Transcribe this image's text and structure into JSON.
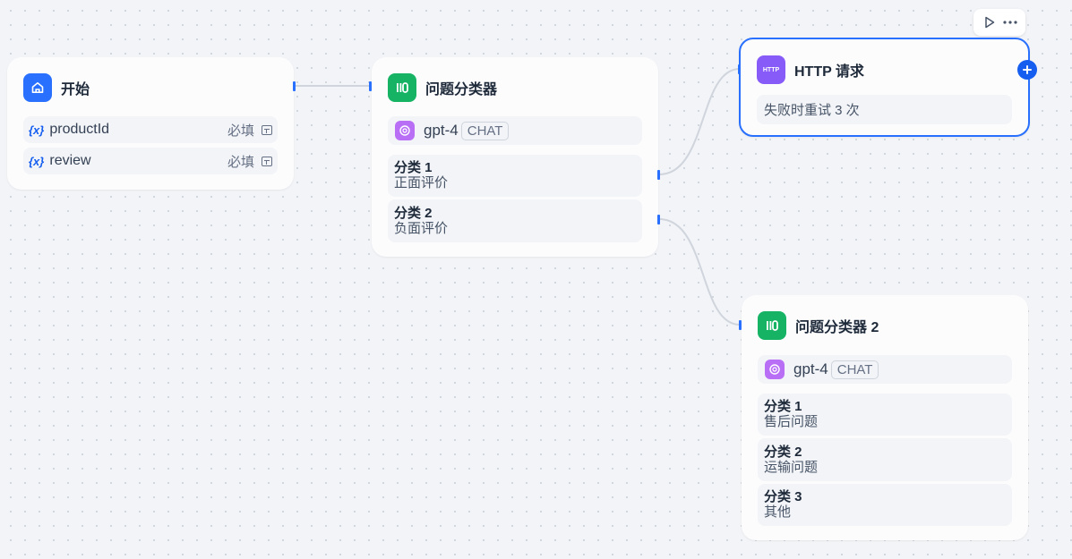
{
  "colors": {
    "accent": "#2970ff",
    "start_icon_bg": "#2970ff",
    "classifier_icon_bg": "#16b364",
    "http_icon_bg": "#875bf7",
    "model_icon_bg": "#b86ef5"
  },
  "toolbar": {
    "run_icon": "play-icon",
    "more_icon": "more-icon"
  },
  "start_node": {
    "title": "开始",
    "icon": "home-icon",
    "variables": [
      {
        "icon_text": "{x}",
        "name": "productId",
        "required": "必填"
      },
      {
        "icon_text": "{x}",
        "name": "review",
        "required": "必填"
      }
    ]
  },
  "classifier_node": {
    "title": "问题分类器",
    "icon": "classifier-icon",
    "model": {
      "name": "gpt-4",
      "mode": "CHAT"
    },
    "classes": [
      {
        "name": "分类 1",
        "desc": "正面评价"
      },
      {
        "name": "分类 2",
        "desc": "负面评价"
      }
    ]
  },
  "http_node": {
    "title": "HTTP 请求",
    "icon_text": "HTTP",
    "retry": "失败时重试 3 次"
  },
  "classifier_node_2": {
    "title": "问题分类器 2",
    "icon": "classifier-icon",
    "model": {
      "name": "gpt-4",
      "mode": "CHAT"
    },
    "classes": [
      {
        "name": "分类 1",
        "desc": "售后问题"
      },
      {
        "name": "分类 2",
        "desc": "运输问题"
      },
      {
        "name": "分类 3",
        "desc": "其他"
      }
    ]
  }
}
